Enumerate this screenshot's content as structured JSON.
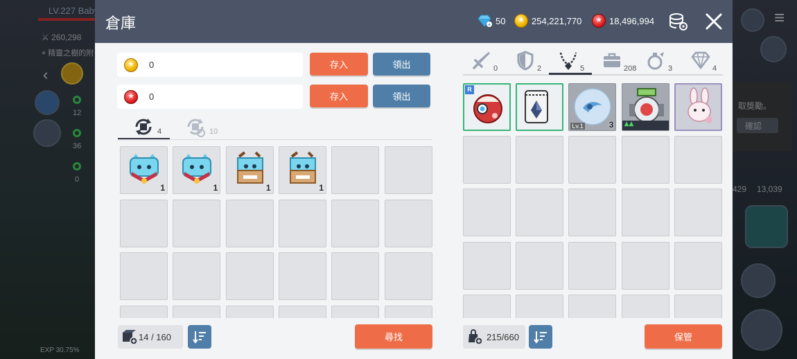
{
  "background": {
    "level_label": "LV.227 Baby",
    "power": "260,298",
    "location": "精靈之樹的附",
    "quest_counts": [
      "12",
      "36",
      "0"
    ],
    "notice_text": "取獎勵。",
    "confirm_label": "確認",
    "item_count_a": "429",
    "item_count_b": "13,039",
    "exp_text": "EXP 30.75%"
  },
  "header": {
    "title": "倉庫",
    "diamonds": "50",
    "meso": "254,221,770",
    "red_points": "18,496,994"
  },
  "left": {
    "meso_value": "0",
    "red_value": "0",
    "deposit_label": "存入",
    "withdraw_label": "領出",
    "tabs": [
      {
        "icon": "storage-cycle-icon",
        "count": "4"
      },
      {
        "icon": "storage-locked-icon",
        "count": "10"
      }
    ],
    "items": [
      {
        "icon": "blue-cat-box-icon",
        "qty": "1"
      },
      {
        "icon": "blue-cat-box-icon",
        "qty": "1"
      },
      {
        "icon": "brown-cat-box-icon",
        "qty": "1"
      },
      {
        "icon": "brown-cat-box-icon",
        "qty": "1"
      }
    ],
    "capacity": "14 / 160",
    "search_label": "尋找"
  },
  "right": {
    "tabs": [
      {
        "icon": "sword-icon",
        "count": "0"
      },
      {
        "icon": "shield-icon",
        "count": "2"
      },
      {
        "icon": "necklace-icon",
        "count": "5"
      },
      {
        "icon": "bag-icon",
        "count": "208"
      },
      {
        "icon": "potion-icon",
        "count": "3"
      },
      {
        "icon": "diamond-icon",
        "count": "4"
      }
    ],
    "items": [
      {
        "icon": "red-orb-icon",
        "badge": "R"
      },
      {
        "icon": "crystal-pouch-icon"
      },
      {
        "icon": "blue-swirl-icon",
        "level": "Lv.1",
        "qty": "3"
      },
      {
        "icon": "green-machine-icon"
      },
      {
        "icon": "rabbit-icon"
      }
    ],
    "capacity": "215/660",
    "store_label": "保管"
  },
  "colors": {
    "header": "#4b5567",
    "orange_button": "#ee6d48",
    "blue_button": "#4f7ea8",
    "slot": "#e1e2e5"
  }
}
